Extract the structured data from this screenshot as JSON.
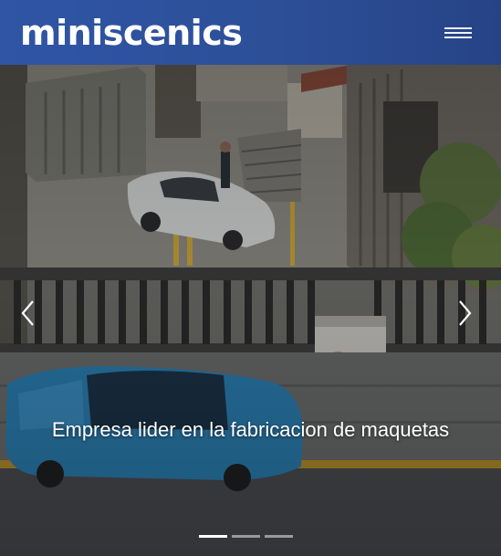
{
  "header": {
    "logo": "miniscenics",
    "menu_icon": "hamburger-menu-icon",
    "background": "#2f55a5"
  },
  "carousel": {
    "caption": "Empresa lider en la fabricacion de maquetas",
    "prev_icon": "chevron-left-icon",
    "next_icon": "chevron-right-icon",
    "slides_count": 3,
    "active_slide": 1,
    "image_subject": "diorama scene"
  }
}
